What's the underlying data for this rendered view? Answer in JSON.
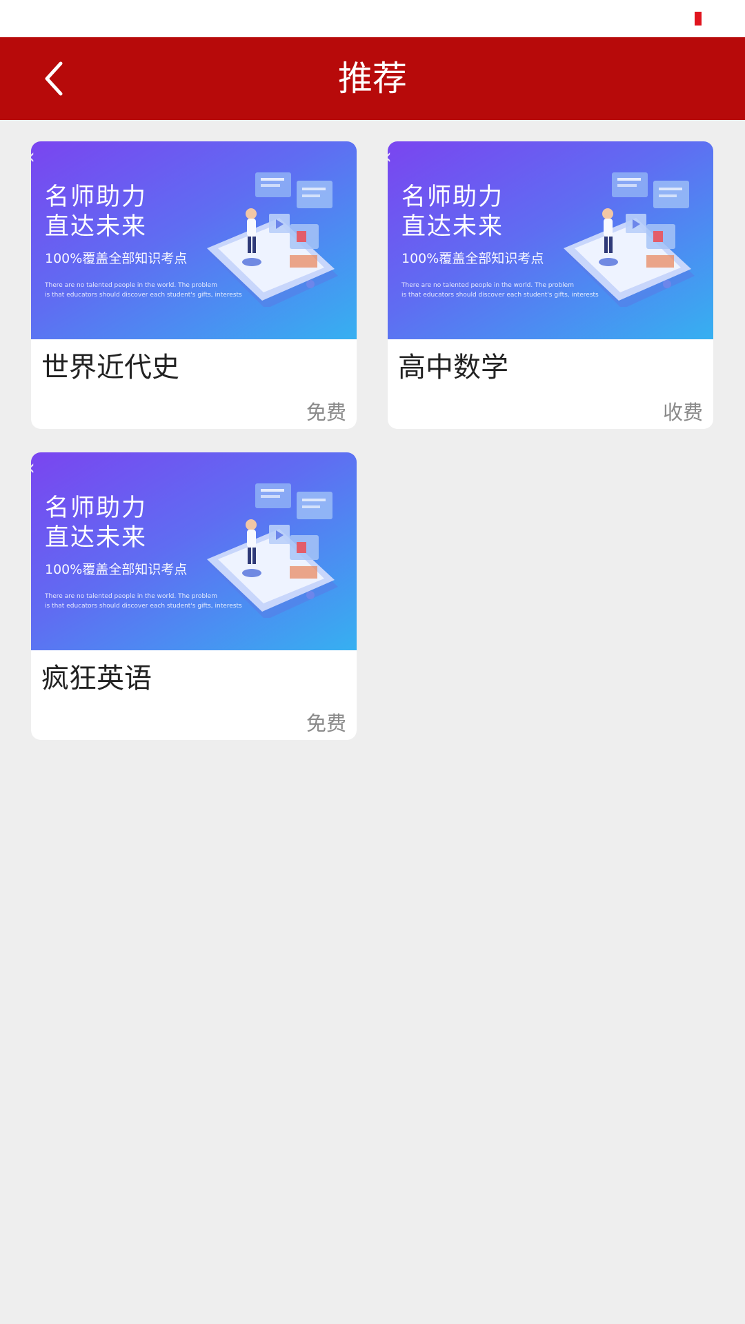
{
  "header": {
    "title": "推荐"
  },
  "banner": {
    "headline_1": "名师助力",
    "headline_2": "直达未来",
    "subtitle": "100%覆盖全部知识考点",
    "english_1": "There are no talented people in the world. The problem",
    "english_2": "is that educators should discover each student's gifts, interests"
  },
  "courses": [
    {
      "title": "世界近代史",
      "price": "免费"
    },
    {
      "title": "高中数学",
      "price": "收费"
    },
    {
      "title": "疯狂英语",
      "price": "免费"
    }
  ],
  "colors": {
    "header": "#b70a0a",
    "background": "#eeeeee",
    "banner_start": "#7a45f0",
    "banner_end": "#36b0f1"
  }
}
